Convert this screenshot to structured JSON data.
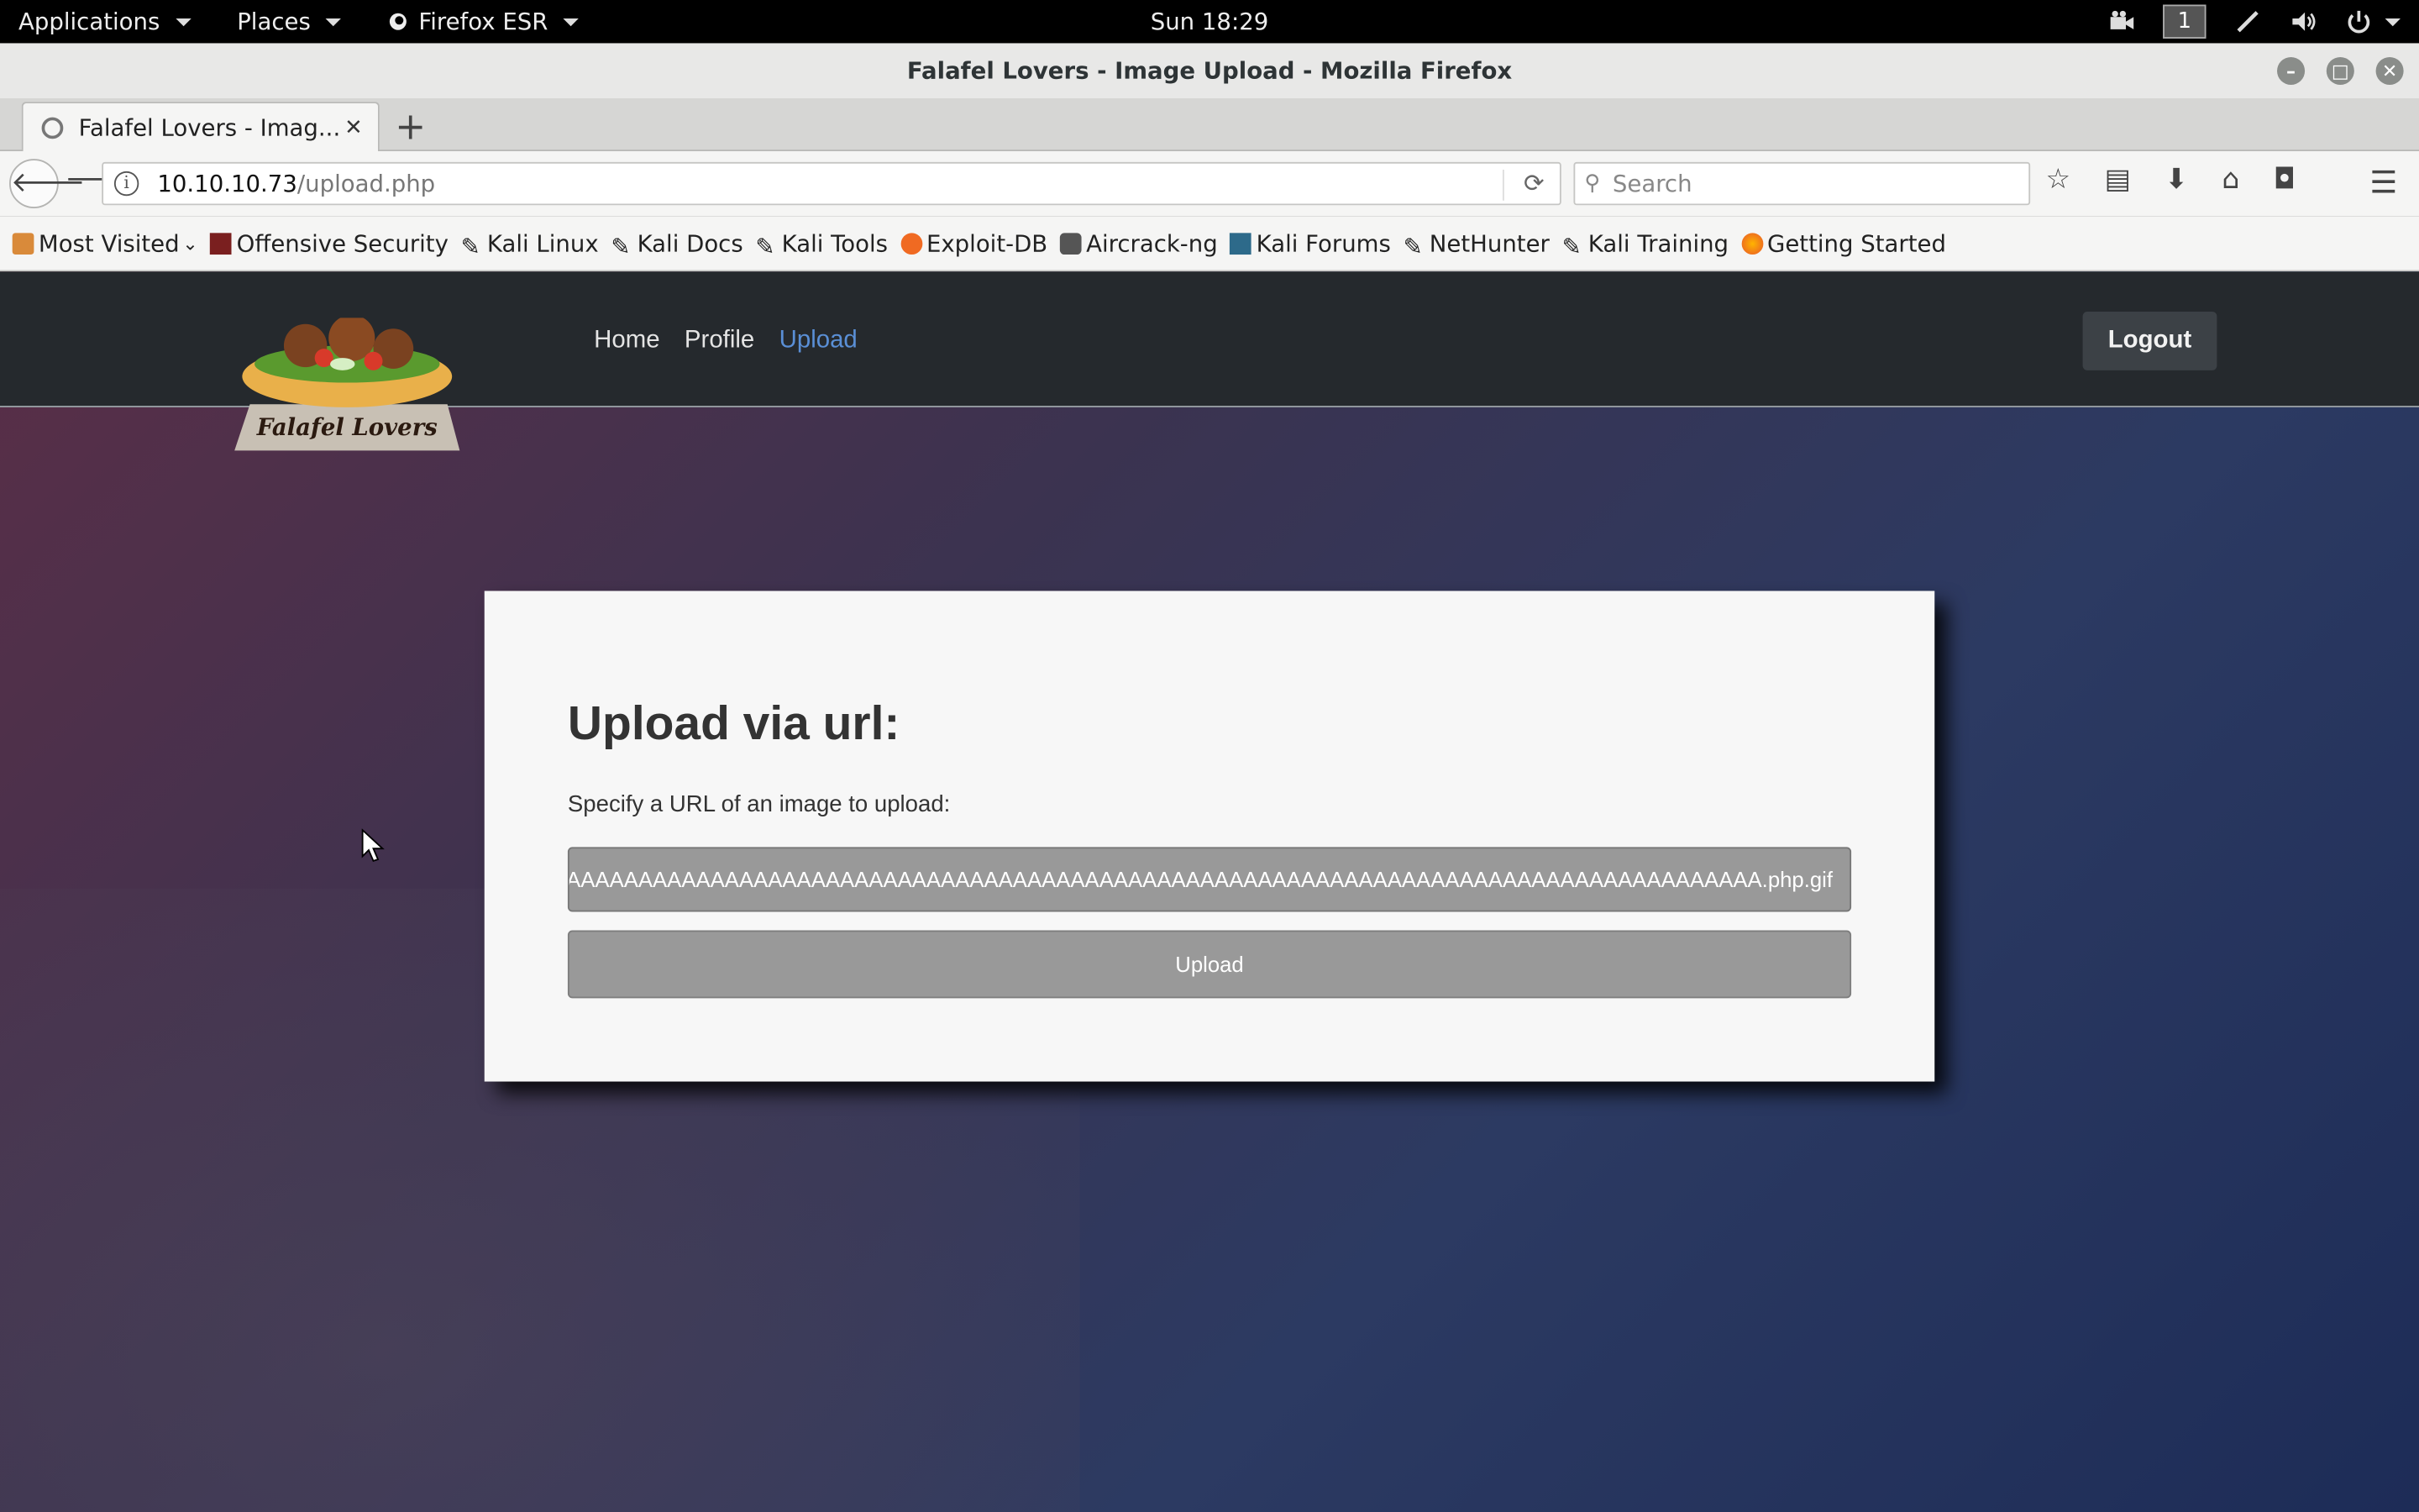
{
  "topbar": {
    "applications": "Applications",
    "places": "Places",
    "firefox": "Firefox ESR",
    "clock": "Sun 18:29",
    "workspace": "1"
  },
  "window": {
    "title": "Falafel Lovers - Image Upload - Mozilla Firefox"
  },
  "tabs": [
    {
      "label": "Falafel Lovers - Imag...",
      "icon": "globe-icon"
    }
  ],
  "navbar": {
    "url_host": "10.10.10.73",
    "url_path": "/upload.php",
    "search_placeholder": "Search"
  },
  "bookmarks": [
    {
      "label": "Most Visited",
      "icon": "folder-icon"
    },
    {
      "label": "Offensive Security",
      "icon": "offsec-icon"
    },
    {
      "label": "Kali Linux",
      "icon": "kali-icon"
    },
    {
      "label": "Kali Docs",
      "icon": "kali-icon"
    },
    {
      "label": "Kali Tools",
      "icon": "kali-icon"
    },
    {
      "label": "Exploit-DB",
      "icon": "exploitdb-icon"
    },
    {
      "label": "Aircrack-ng",
      "icon": "aircrack-icon"
    },
    {
      "label": "Kali Forums",
      "icon": "forums-icon"
    },
    {
      "label": "NetHunter",
      "icon": "kali-icon"
    },
    {
      "label": "Kali Training",
      "icon": "kali-icon"
    },
    {
      "label": "Getting Started",
      "icon": "firefox-icon"
    }
  ],
  "site": {
    "logo_text": "Falafel Lovers",
    "nav": [
      {
        "label": "Home",
        "active": false
      },
      {
        "label": "Profile",
        "active": false
      },
      {
        "label": "Upload",
        "active": true
      }
    ],
    "logout": "Logout"
  },
  "upload": {
    "heading": "Upload via url:",
    "description": "Specify a URL of an image to upload:",
    "input_value": "AAAAAAAAAAAAAAAAAAAAAAAAAAAAAAAAAAAAAAAAAAAAAAAAAAAAAAAAAAAAAAAAAAAAAAAAAAAAAAAAAAAAAAAAAAAAAAAAAAAAAAAAAAAAAAAAAAAAAAAAAAAAAAAAAAAAAAAAAAAAAAAAAAAAAAAAAAAAAAAAAAAAAAAAAAAAAAAAAAAAAAAAAAAAAAAAAAAAAAAAAAAAAAAAAAAAAAAAAAAAA.php.gif",
    "button": "Upload"
  },
  "colors": {
    "accent_link": "#5a8fd6",
    "site_nav_bg": "#25292d",
    "input_bg": "#999999"
  }
}
